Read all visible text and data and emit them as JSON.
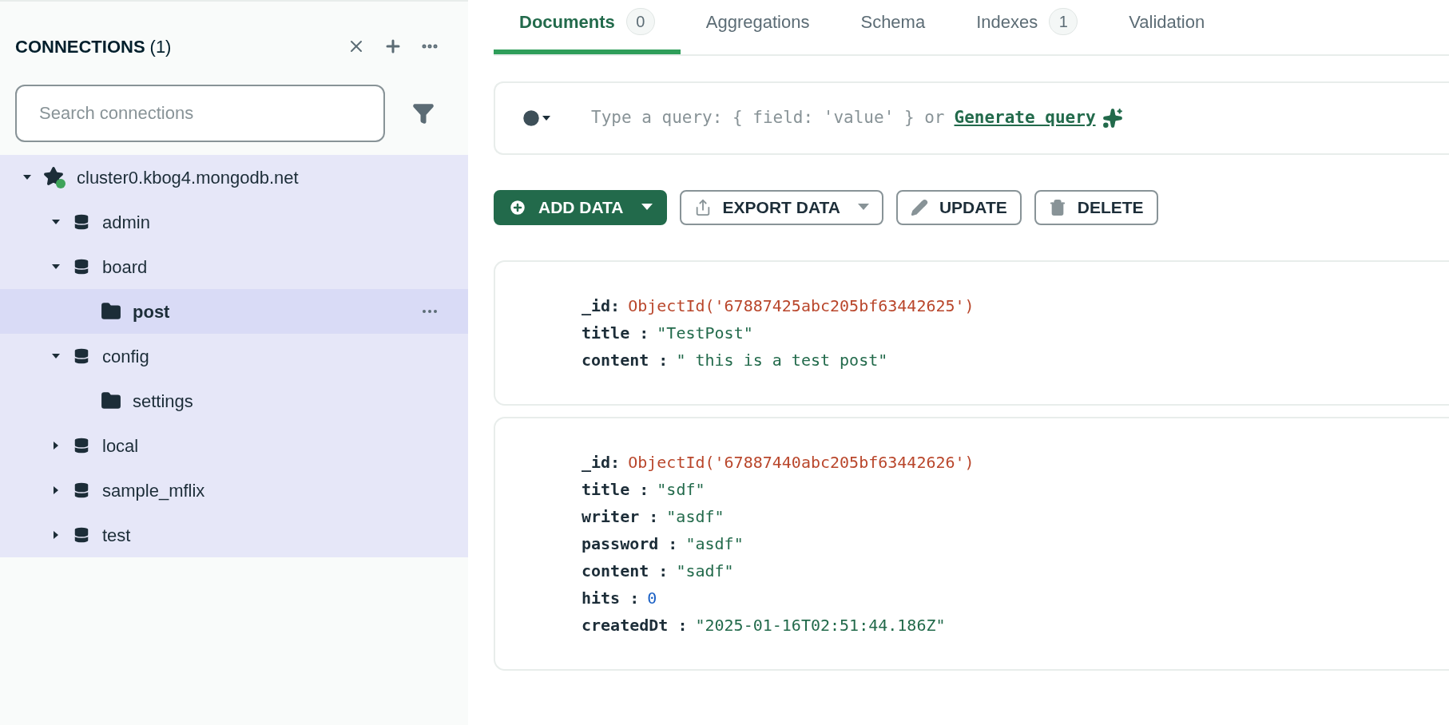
{
  "sidebar": {
    "title": "CONNECTIONS",
    "count": "(1)",
    "search": {
      "placeholder": "Search connections"
    },
    "tree": [
      {
        "kind": "connection",
        "label": "cluster0.kbog4.mongodb.net",
        "expanded": true,
        "selected": false,
        "children": [
          {
            "kind": "database",
            "label": "admin",
            "expanded": true,
            "selected": false
          },
          {
            "kind": "database",
            "label": "board",
            "expanded": true,
            "selected": false,
            "children": [
              {
                "kind": "collection",
                "label": "post",
                "selected": true
              }
            ]
          },
          {
            "kind": "database",
            "label": "config",
            "expanded": true,
            "selected": false,
            "children": [
              {
                "kind": "collection",
                "label": "settings",
                "selected": false
              }
            ]
          },
          {
            "kind": "database",
            "label": "local",
            "expanded": false,
            "selected": false
          },
          {
            "kind": "database",
            "label": "sample_mflix",
            "expanded": false,
            "selected": false
          },
          {
            "kind": "database",
            "label": "test",
            "expanded": false,
            "selected": false
          }
        ]
      }
    ]
  },
  "tabs": [
    {
      "label": "Documents",
      "badge": "0",
      "selected": true
    },
    {
      "label": "Aggregations",
      "selected": false
    },
    {
      "label": "Schema",
      "selected": false
    },
    {
      "label": "Indexes",
      "badge": "1",
      "selected": false
    },
    {
      "label": "Validation",
      "selected": false
    }
  ],
  "query": {
    "placeholder": "Type a query: { field: 'value' } or",
    "link": "Generate query"
  },
  "actions": [
    {
      "kind": "add",
      "label": "ADD DATA"
    },
    {
      "kind": "export",
      "label": "EXPORT DATA"
    },
    {
      "kind": "update",
      "label": "UPDATE"
    },
    {
      "kind": "delete",
      "label": "DELETE"
    }
  ],
  "documents": [
    {
      "fields": [
        {
          "key": "_id:",
          "kind": "objectid",
          "value": "ObjectId('67887425abc205bf63442625')"
        },
        {
          "key": "title :",
          "kind": "string",
          "value": "\"TestPost\""
        },
        {
          "key": "content :",
          "kind": "string",
          "value": "\" this is a test post\""
        }
      ]
    },
    {
      "fields": [
        {
          "key": "_id:",
          "kind": "objectid",
          "value": "ObjectId('67887440abc205bf63442626')"
        },
        {
          "key": "title :",
          "kind": "string",
          "value": "\"sdf\""
        },
        {
          "key": "writer :",
          "kind": "string",
          "value": "\"asdf\""
        },
        {
          "key": "password :",
          "kind": "string",
          "value": "\"asdf\""
        },
        {
          "key": "content :",
          "kind": "string",
          "value": "\"sadf\""
        },
        {
          "key": "hits :",
          "kind": "number",
          "value": "0"
        },
        {
          "key": "createdDt :",
          "kind": "string",
          "value": "\"2025-01-16T02:51:44.186Z\""
        }
      ]
    }
  ]
}
